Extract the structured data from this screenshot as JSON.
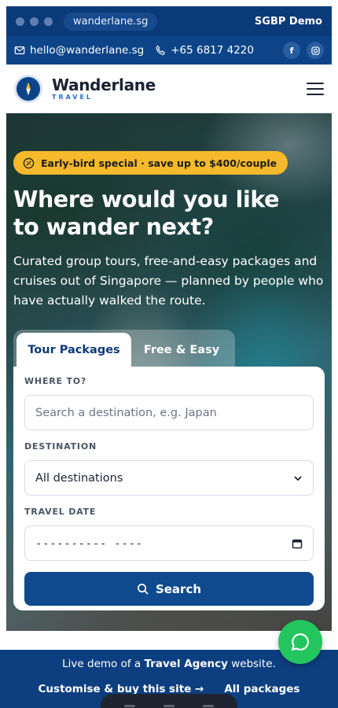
{
  "browser": {
    "url": "wanderlane.sg",
    "demo_label": "SGBP Demo"
  },
  "contact": {
    "email": "hello@wanderlane.sg",
    "phone": "+65 6817 4220",
    "social": [
      "facebook-icon",
      "instagram-icon"
    ]
  },
  "header": {
    "brand_name": "Wanderlane",
    "brand_sub": "TRAVEL",
    "menu_icon": "hamburger-menu-icon"
  },
  "hero": {
    "promo": "Early-bird special · save up to $400/couple",
    "title_line1": "Where would you like",
    "title_line2": "to wander next?",
    "subtitle": "Curated group tours, free-and-easy packages and cruises out of Singapore — planned by people who have actually walked the route."
  },
  "search_form": {
    "tabs": [
      {
        "label": "Tour Packages",
        "active": true
      },
      {
        "label": "Free & Easy",
        "active": false
      }
    ],
    "where_label": "WHERE TO?",
    "where_placeholder": "Search a destination, e.g. Japan",
    "destination_label": "DESTINATION",
    "destination_value": "All destinations",
    "date_label": "TRAVEL DATE",
    "date_value": "---------- ----",
    "search_button": "Search"
  },
  "footer": {
    "text_prefix": "Live demo of a ",
    "text_bold": "Travel Agency",
    "text_suffix": " website.",
    "link_customise": "Customise & buy this site →",
    "link_packages": "All packages"
  },
  "colors": {
    "primary": "#0d4488",
    "accent": "#f5b92b",
    "chat": "#22c55e"
  }
}
